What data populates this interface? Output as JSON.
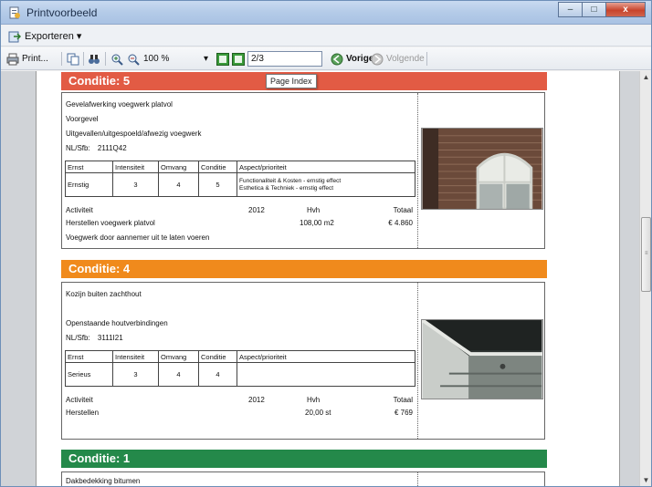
{
  "window": {
    "title": "Printvoorbeeld",
    "min_label": "–",
    "max_label": "□",
    "close_label": "x"
  },
  "menubar": {
    "export_label": "Exporteren ▾"
  },
  "toolbar": {
    "print_label": "Print...",
    "zoom_value": "100 %",
    "zoom_arrow": "▾",
    "page_value": "2/3",
    "prev_label": "Vorige",
    "next_label": "Volgende",
    "tooltip": "Page Index"
  },
  "sections": [
    {
      "header": "Conditie:  5",
      "color": "#e25b44",
      "lines": [
        "Gevelafwerking voegwerk platvol",
        "Voorgevel",
        "Uitgevallen/uitgespoeld/afwezig voegwerk"
      ],
      "nlsfb_label": "NL/Sfb:",
      "nlsfb_value": "2111Q42",
      "table_headers": [
        "Ernst",
        "Intensiteit",
        "Omvang",
        "Conditie",
        "Aspect/prioriteit"
      ],
      "table_values": [
        "Ernstig",
        "3",
        "4",
        "5"
      ],
      "aspect_lines": [
        "Functionaliteit & Kosten - ernstig effect",
        "Esthetica & Techniek - ernstig effect"
      ],
      "activity_header": {
        "label": "Activiteit",
        "year": "2012",
        "unit": "Hvh",
        "total": "Totaal"
      },
      "activity": {
        "label": "Herstellen voegwerk platvol",
        "qty": "108,00  m2",
        "total": "€ 4.860"
      },
      "extra": "Voegwerk door aannemer uit te laten voeren",
      "photo": "brick-facade-window-photo"
    },
    {
      "header": "Conditie:  4",
      "color": "#f08a1c",
      "lines": [
        "Kozijn buiten zachthout",
        "",
        "Openstaande houtverbindingen"
      ],
      "nlsfb_label": "NL/Sfb:",
      "nlsfb_value": "3111I21",
      "table_headers": [
        "Ernst",
        "Intensiteit",
        "Omvang",
        "Conditie",
        "Aspect/prioriteit"
      ],
      "table_values": [
        "Serieus",
        "3",
        "4",
        "4"
      ],
      "aspect_lines": [
        "",
        ""
      ],
      "activity_header": {
        "label": "Activiteit",
        "year": "2012",
        "unit": "Hvh",
        "total": "Totaal"
      },
      "activity": {
        "label": "Herstellen",
        "qty": "20,00  st",
        "total": "€ 769"
      },
      "extra": "",
      "photo": "window-frame-closeup-photo"
    },
    {
      "header": "Conditie:  1",
      "color": "#24894a",
      "lines": [
        "Dakbedekking bitumen"
      ]
    }
  ]
}
